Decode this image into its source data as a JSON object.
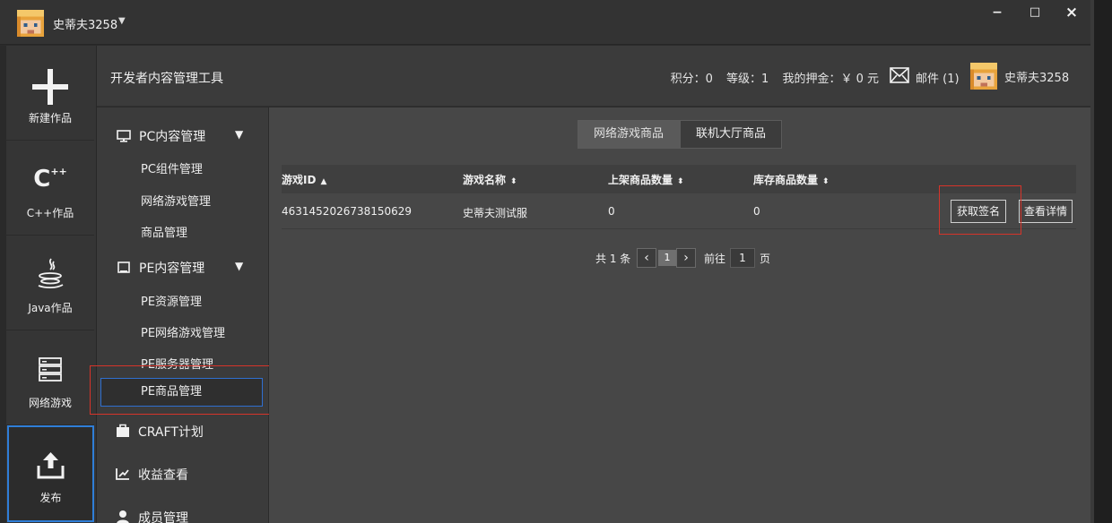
{
  "titlebar": {
    "username": "史蒂夫3258",
    "minimize": "−",
    "maximize": "□",
    "close": "×"
  },
  "leftnav": {
    "items": [
      {
        "label": "新建作品",
        "icon": "plus-icon"
      },
      {
        "label": "C++作品",
        "icon": "cpp-icon"
      },
      {
        "label": "Java作品",
        "icon": "java-icon"
      },
      {
        "label": "网络游戏",
        "icon": "server-icon"
      },
      {
        "label": "发布",
        "icon": "upload-icon"
      }
    ]
  },
  "header": {
    "title": "开发者内容管理工具",
    "points": "积分：0",
    "level": "等级：1",
    "deposit": "我的押金：￥ 0 元",
    "mail": "邮件 (1)",
    "username": "史蒂夫3258"
  },
  "sidebar": {
    "pc_section": "PC内容管理",
    "pc_items": [
      "PC组件管理",
      "网络游戏管理",
      "商品管理"
    ],
    "pe_section": "PE内容管理",
    "pe_items": [
      "PE资源管理",
      "PE网络游戏管理",
      "PE服务器管理",
      "PE商品管理"
    ],
    "craft": "CRAFT计划",
    "revenue": "收益查看",
    "members": "成员管理"
  },
  "main": {
    "tabs": [
      "网络游戏商品",
      "联机大厅商品"
    ],
    "columns": [
      "游戏ID",
      "游戏名称",
      "上架商品数量",
      "库存商品数量"
    ],
    "rows": [
      {
        "id": "4631452026738150629",
        "name": "史蒂夫测试服",
        "listed": "0",
        "stock": "0"
      }
    ],
    "actions": [
      "获取签名",
      "查看详情"
    ],
    "pager": {
      "total": "共 1 条",
      "page": "1",
      "goto": "前往",
      "goto_value": "1",
      "unit": "页"
    }
  },
  "colors": {
    "highlight_red": "#d6342a",
    "active_blue": "#2f7ed8"
  }
}
